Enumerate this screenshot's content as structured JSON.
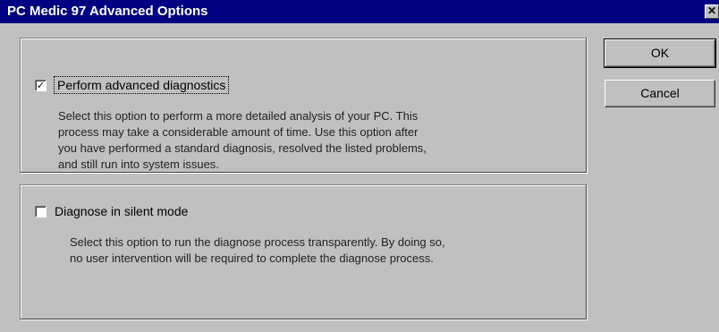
{
  "window": {
    "title": "PC Medic 97 Advanced Options",
    "close_glyph": "✕"
  },
  "options": [
    {
      "label": "Perform advanced diagnostics",
      "checked": true,
      "check_glyph": "✓",
      "description": [
        "Select this option to perform a more detailed analysis of your PC.  This",
        "process may take a considerable amount of time.  Use this option after",
        "you have performed a standard diagnosis, resolved the listed problems,",
        "and still run into system issues."
      ]
    },
    {
      "label": "Diagnose in silent mode",
      "checked": false,
      "check_glyph": "",
      "description": [
        "Select this option to run the diagnose process transparently.  By doing so,",
        "no user intervention will be required to complete the diagnose process."
      ]
    }
  ],
  "buttons": {
    "ok_label": "OK",
    "cancel_label": "Cancel"
  },
  "colors": {
    "titlebar": "#000080",
    "face": "#c0c0c0"
  }
}
